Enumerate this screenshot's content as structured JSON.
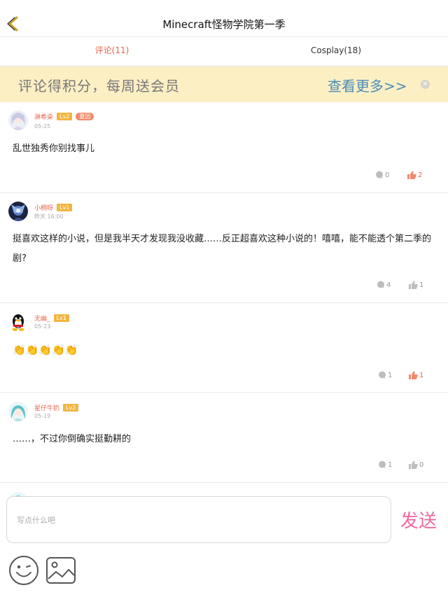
{
  "header": {
    "title": "Minecraft怪物学院第一季"
  },
  "tabs": [
    {
      "label": "评论(11)"
    },
    {
      "label": "Cosplay(18)"
    }
  ],
  "banner": {
    "text": "评论得积分，每周送会员",
    "link": "查看更多>>"
  },
  "comments": [
    {
      "user": "淋希染",
      "level": "Lv2",
      "badge": "夏团",
      "time": "05-25",
      "content": "乱世独秀你别找事儿",
      "replies": "0",
      "likes": "2",
      "liked": true
    },
    {
      "user": "小桐呀",
      "level": "Lv1",
      "time": "昨天 16:00",
      "content": "挺喜欢这样的小说，但是我半天才发现我没收藏……反正超喜欢这种小说的！嘻嘻，能不能透个第二季的剧?",
      "replies": "4",
      "likes": "1",
      "liked": false
    },
    {
      "user": "无幽_",
      "level": "Lv1",
      "time": "05-23",
      "content": "👏👏👏👏👏",
      "replies": "1",
      "likes": "1",
      "liked": true
    },
    {
      "user": "星仔牛奶",
      "level": "Lv2",
      "time": "05-19",
      "content": "……，不过你倒确实挺勤耕的",
      "replies": "1",
      "likes": "0",
      "liked": false
    }
  ],
  "input": {
    "placeholder": "写点什么吧"
  },
  "send_label": "发送",
  "colors": {
    "accent": "#e8664a",
    "banner_bg": "#fcefc4",
    "link": "#4a8db8",
    "send": "#f06aa1",
    "level_badge": "#f2b541"
  },
  "icons": [
    "back-arrow-icon",
    "close-icon",
    "comment-bubble-icon",
    "thumbs-up-icon",
    "emoji-icon",
    "image-icon"
  ]
}
